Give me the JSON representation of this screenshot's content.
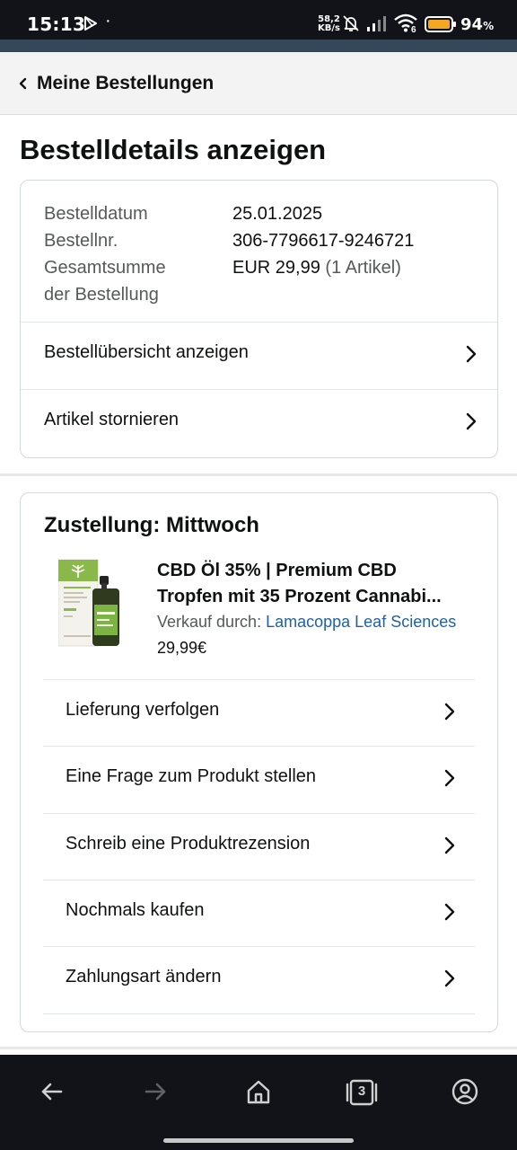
{
  "status_bar": {
    "time": "15:13",
    "net_speed_value": "58,2",
    "net_speed_unit": "KB/s",
    "wifi_badge": "6",
    "battery_percent": "94",
    "battery_suffix": "%",
    "icons": [
      "play-store-icon",
      "mute-bell-icon",
      "signal-icon",
      "wifi-icon",
      "battery-icon"
    ]
  },
  "header": {
    "back_label": "Meine Bestellungen"
  },
  "page_title": "Bestelldetails anzeigen",
  "order_info": {
    "date_label": "Bestelldatum",
    "date_value": "25.01.2025",
    "number_label": "Bestellnr.",
    "number_value": "306-7796617-9246721",
    "total_label": "Gesamtsumme der Bestellung",
    "total_value": "EUR 29,99",
    "total_items": "(1 Artikel)"
  },
  "order_actions": [
    {
      "label": "Bestellübersicht anzeigen"
    },
    {
      "label": "Artikel stornieren"
    }
  ],
  "delivery": {
    "title": "Zustellung: Mittwoch",
    "product": {
      "title_line1": "CBD Öl 35% | Premium CBD",
      "title_line2": "Tropfen mit 35 Prozent Cannabi...",
      "seller_prefix": "Verkauf durch:",
      "seller_name": "Lamacoppa Leaf Sciences",
      "price": "29,99€"
    },
    "actions": [
      {
        "label": "Lieferung verfolgen"
      },
      {
        "label": "Eine Frage zum Produkt stellen"
      },
      {
        "label": "Schreib eine Produktrezension"
      },
      {
        "label": "Nochmals kaufen"
      },
      {
        "label": "Zahlungsart ändern"
      }
    ]
  },
  "nav_bar": {
    "tab_count": "3",
    "icons": [
      "back-arrow-icon",
      "forward-arrow-icon",
      "home-icon",
      "tabs-icon",
      "account-icon"
    ]
  },
  "colors": {
    "link": "#2162a1",
    "text": "#0f1111",
    "muted": "#565959",
    "header_bg": "#f3f3f3",
    "accent_strip": "#37475a",
    "status_bg": "#111318"
  }
}
